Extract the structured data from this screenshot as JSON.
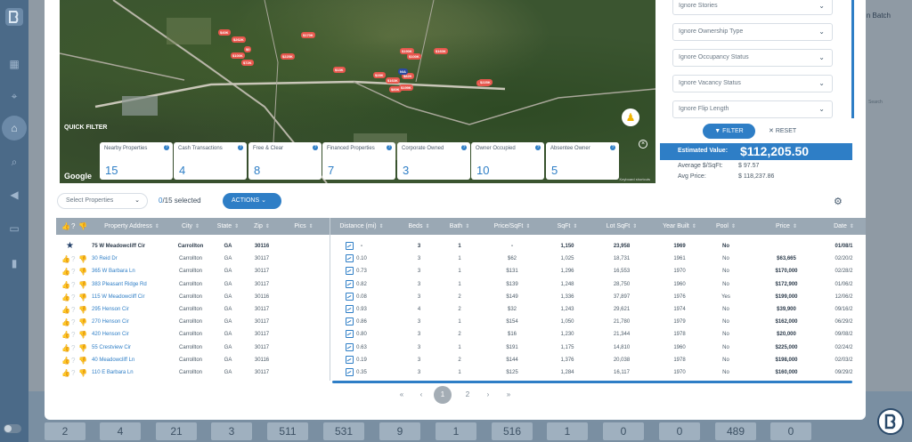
{
  "app": {
    "batch_label": "n Batch",
    "bg_search": "Search"
  },
  "sidebar": {
    "icons": [
      "dashboard-icon",
      "location-pin-icon",
      "home-icon",
      "home-search-icon",
      "megaphone-icon",
      "chat-icon",
      "bar-chart-icon"
    ]
  },
  "bottom_numbers": [
    "2",
    "4",
    "21",
    "3",
    "511",
    "531",
    "9",
    "1",
    "516",
    "1",
    "0",
    "0",
    "489",
    "0"
  ],
  "map": {
    "quick_filter_label": "QUICK FILTER",
    "google_label": "Google",
    "credit": "Keyboard shortcuts",
    "pins": [
      "$40K",
      "$262K",
      "$0",
      "$100K",
      "$72K",
      "$225K",
      "$170K",
      "$13K",
      "$190K",
      "$28K",
      "$163K",
      "$80K",
      "$82K",
      "$225K",
      "$97K",
      "$160K",
      "$100K",
      "N/A",
      "$199K",
      "$225K"
    ]
  },
  "quick_filters": [
    {
      "label": "Nearby Properties",
      "value": "15"
    },
    {
      "label": "Cash Transactions",
      "value": "4"
    },
    {
      "label": "Free & Clear",
      "value": "8"
    },
    {
      "label": "Financed Properties",
      "value": "7"
    },
    {
      "label": "Corporate Owned",
      "value": "3"
    },
    {
      "label": "Owner Occupied",
      "value": "10"
    },
    {
      "label": "Absentee Owner",
      "value": "5"
    }
  ],
  "filters": {
    "selects": [
      "Ignore Stories",
      "Ignore Ownership Type",
      "Ignore Occupancy Status",
      "Ignore Vacancy Status",
      "Ignore Flip Length"
    ],
    "filter_label": "FILTER",
    "reset_label": "RESET",
    "estimated_label": "Estimated Value:",
    "estimated_value": "$112,205.50",
    "avg_sqft_label": "Average $/SqFt:",
    "avg_sqft_value": "$ 97.57",
    "avg_price_label": "Avg Price:",
    "avg_price_value": "$ 118,237.86"
  },
  "toolbar": {
    "select_placeholder": "Select Properties",
    "selected_count": "0",
    "selected_total": "/15 selected",
    "actions_label": "ACTIONS"
  },
  "table": {
    "headers": [
      "Property Address",
      "City",
      "State",
      "Zip",
      "Pics",
      "Distance (mi)",
      "Beds",
      "Bath",
      "Price/SqFt",
      "SqFt",
      "Lot SqFt",
      "Year Built",
      "Pool",
      "Price",
      "Date"
    ],
    "rows": [
      {
        "addr": "75 W Meadowcliff Cir",
        "city": "Carrollton",
        "state": "GA",
        "zip": "30116",
        "dist": "-",
        "beds": "3",
        "bath": "1",
        "ppsf": "-",
        "sqft": "1,150",
        "lot": "23,958",
        "year": "1969",
        "pool": "No",
        "price": "",
        "date": "01/08/1"
      },
      {
        "addr": "30 Reid Dr",
        "city": "Carrollton",
        "state": "GA",
        "zip": "30117",
        "dist": "0.10",
        "beds": "3",
        "bath": "1",
        "ppsf": "$62",
        "sqft": "1,025",
        "lot": "18,731",
        "year": "1961",
        "pool": "No",
        "price": "$63,665",
        "date": "02/20/2"
      },
      {
        "addr": "365 W Barbara Ln",
        "city": "Carrollton",
        "state": "GA",
        "zip": "30117",
        "dist": "0.73",
        "beds": "3",
        "bath": "1",
        "ppsf": "$131",
        "sqft": "1,296",
        "lot": "16,553",
        "year": "1970",
        "pool": "No",
        "price": "$170,000",
        "date": "02/28/2"
      },
      {
        "addr": "383 Pleasant Ridge Rd",
        "city": "Carrollton",
        "state": "GA",
        "zip": "30117",
        "dist": "0.82",
        "beds": "3",
        "bath": "1",
        "ppsf": "$139",
        "sqft": "1,248",
        "lot": "28,750",
        "year": "1960",
        "pool": "No",
        "price": "$172,900",
        "date": "01/06/2"
      },
      {
        "addr": "115 W Meadowcliff Cir",
        "city": "Carrollton",
        "state": "GA",
        "zip": "30116",
        "dist": "0.08",
        "beds": "3",
        "bath": "2",
        "ppsf": "$149",
        "sqft": "1,336",
        "lot": "37,897",
        "year": "1976",
        "pool": "Yes",
        "price": "$199,000",
        "date": "12/06/2"
      },
      {
        "addr": "295 Henson Cir",
        "city": "Carrollton",
        "state": "GA",
        "zip": "30117",
        "dist": "0.93",
        "beds": "4",
        "bath": "2",
        "ppsf": "$32",
        "sqft": "1,243",
        "lot": "29,621",
        "year": "1974",
        "pool": "No",
        "price": "$39,900",
        "date": "09/16/2"
      },
      {
        "addr": "270 Henson Cir",
        "city": "Carrollton",
        "state": "GA",
        "zip": "30117",
        "dist": "0.86",
        "beds": "3",
        "bath": "1",
        "ppsf": "$154",
        "sqft": "1,050",
        "lot": "21,780",
        "year": "1979",
        "pool": "No",
        "price": "$162,000",
        "date": "06/29/2"
      },
      {
        "addr": "420 Henson Cir",
        "city": "Carrollton",
        "state": "GA",
        "zip": "30117",
        "dist": "0.80",
        "beds": "3",
        "bath": "2",
        "ppsf": "$16",
        "sqft": "1,230",
        "lot": "21,344",
        "year": "1978",
        "pool": "No",
        "price": "$20,000",
        "date": "09/08/2"
      },
      {
        "addr": "55 Crestview Cir",
        "city": "Carrollton",
        "state": "GA",
        "zip": "30117",
        "dist": "0.63",
        "beds": "3",
        "bath": "1",
        "ppsf": "$191",
        "sqft": "1,175",
        "lot": "14,810",
        "year": "1960",
        "pool": "No",
        "price": "$225,000",
        "date": "02/24/2"
      },
      {
        "addr": "40 Meadowcliff Ln",
        "city": "Carrollton",
        "state": "GA",
        "zip": "30116",
        "dist": "0.19",
        "beds": "3",
        "bath": "2",
        "ppsf": "$144",
        "sqft": "1,376",
        "lot": "20,038",
        "year": "1978",
        "pool": "No",
        "price": "$198,000",
        "date": "02/03/2"
      },
      {
        "addr": "110 E Barbara Ln",
        "city": "Carrollton",
        "state": "GA",
        "zip": "30117",
        "dist": "0.35",
        "beds": "3",
        "bath": "1",
        "ppsf": "$125",
        "sqft": "1,284",
        "lot": "16,117",
        "year": "1970",
        "pool": "No",
        "price": "$160,000",
        "date": "09/29/2"
      }
    ]
  },
  "pagination": {
    "first": "«",
    "prev": "‹",
    "pages": [
      "1",
      "2"
    ],
    "next": "›",
    "last": "»",
    "current": "1"
  },
  "colors": {
    "accent": "#2e7ec6",
    "header": "#9aa8b4"
  }
}
